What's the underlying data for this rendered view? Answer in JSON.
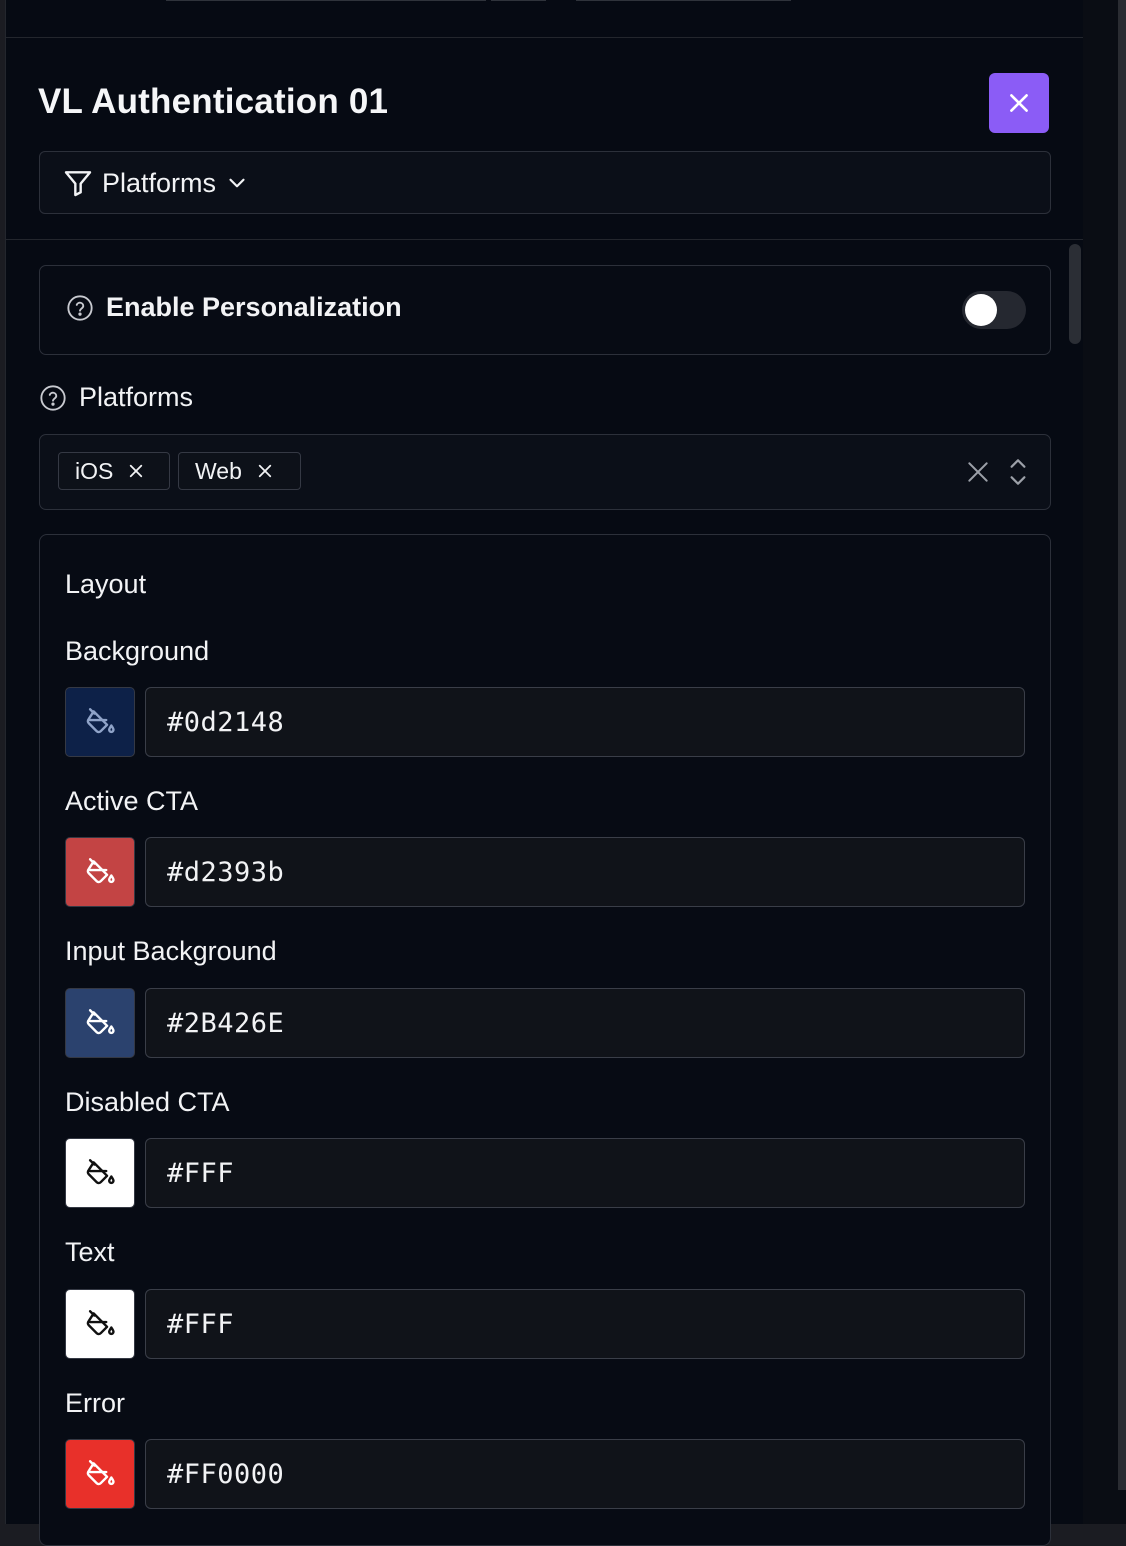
{
  "header": {
    "title": "VL Authentication 01",
    "close_icon": "close-icon"
  },
  "filter": {
    "label": "Platforms",
    "icon": "filter-icon",
    "chevron": "chevron-down-icon"
  },
  "personalization": {
    "label": "Enable Personalization",
    "enabled": false
  },
  "platforms": {
    "label": "Platforms",
    "selected": [
      "iOS",
      "Web"
    ]
  },
  "layout": {
    "title": "Layout",
    "colors": [
      {
        "label": "Background",
        "value": "#0d2148",
        "swatch": "#0d2148",
        "icon_color": "#8fa3c8"
      },
      {
        "label": "Active CTA",
        "value": "#d2393b",
        "swatch": "#c34444",
        "icon_color": "#ffffff"
      },
      {
        "label": "Input Background",
        "value": "#2B426E",
        "swatch": "#2b426e",
        "icon_color": "#ffffff"
      },
      {
        "label": "Disabled CTA",
        "value": "#FFF",
        "swatch": "#ffffff",
        "icon_color": "#111111"
      },
      {
        "label": "Text",
        "value": "#FFF",
        "swatch": "#ffffff",
        "icon_color": "#111111"
      },
      {
        "label": "Error",
        "value": "#FF0000",
        "swatch": "#e8302a",
        "icon_color": "#ffffff"
      }
    ]
  },
  "colors": {
    "accent": "#8b5cf6",
    "panel_bg": "#060a13",
    "border": "#2c303a"
  }
}
